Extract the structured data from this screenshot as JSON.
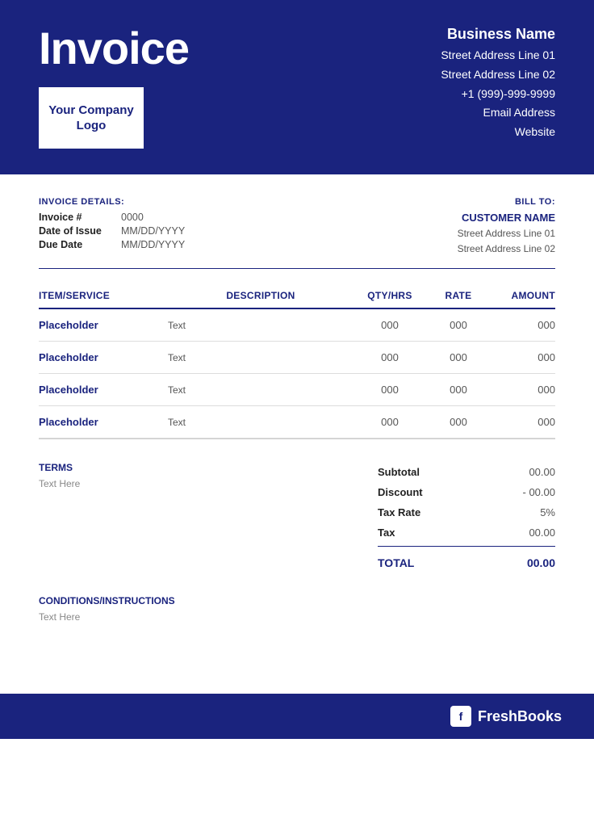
{
  "header": {
    "invoice_title": "Invoice",
    "logo_text": "Your Company Logo",
    "business_name": "Business Name",
    "address_line1": "Street Address Line 01",
    "address_line2": "Street Address Line 02",
    "phone": "+1 (999)-999-9999",
    "email": "Email Address",
    "website": "Website"
  },
  "invoice_details": {
    "section_label": "INVOICE DETAILS:",
    "fields": [
      {
        "key": "Invoice #",
        "value": "0000"
      },
      {
        "key": "Date of Issue",
        "value": "MM/DD/YYYY"
      },
      {
        "key": "Due Date",
        "value": "MM/DD/YYYY"
      }
    ]
  },
  "bill_to": {
    "label": "BILL TO:",
    "customer_name": "CUSTOMER NAME",
    "address_line1": "Street Address Line 01",
    "address_line2": "Street Address Line 02"
  },
  "table": {
    "headers": [
      "ITEM/SERVICE",
      "DESCRIPTION",
      "QTY/HRS",
      "RATE",
      "AMOUNT"
    ],
    "rows": [
      {
        "item": "Placeholder",
        "description": "Text",
        "qty": "000",
        "rate": "000",
        "amount": "000"
      },
      {
        "item": "Placeholder",
        "description": "Text",
        "qty": "000",
        "rate": "000",
        "amount": "000"
      },
      {
        "item": "Placeholder",
        "description": "Text",
        "qty": "000",
        "rate": "000",
        "amount": "000"
      },
      {
        "item": "Placeholder",
        "description": "Text",
        "qty": "000",
        "rate": "000",
        "amount": "000"
      }
    ]
  },
  "terms": {
    "label": "TERMS",
    "text": "Text Here"
  },
  "conditions": {
    "label": "CONDITIONS/INSTRUCTIONS",
    "text": "Text Here"
  },
  "totals": {
    "subtotal_label": "Subtotal",
    "subtotal_value": "00.00",
    "discount_label": "Discount",
    "discount_value": "- 00.00",
    "tax_rate_label": "Tax Rate",
    "tax_rate_value": "5%",
    "tax_label": "Tax",
    "tax_value": "00.00",
    "total_label": "TOTAL",
    "total_value": "00.00"
  },
  "footer": {
    "brand": "FreshBooks",
    "icon_letter": "f"
  }
}
